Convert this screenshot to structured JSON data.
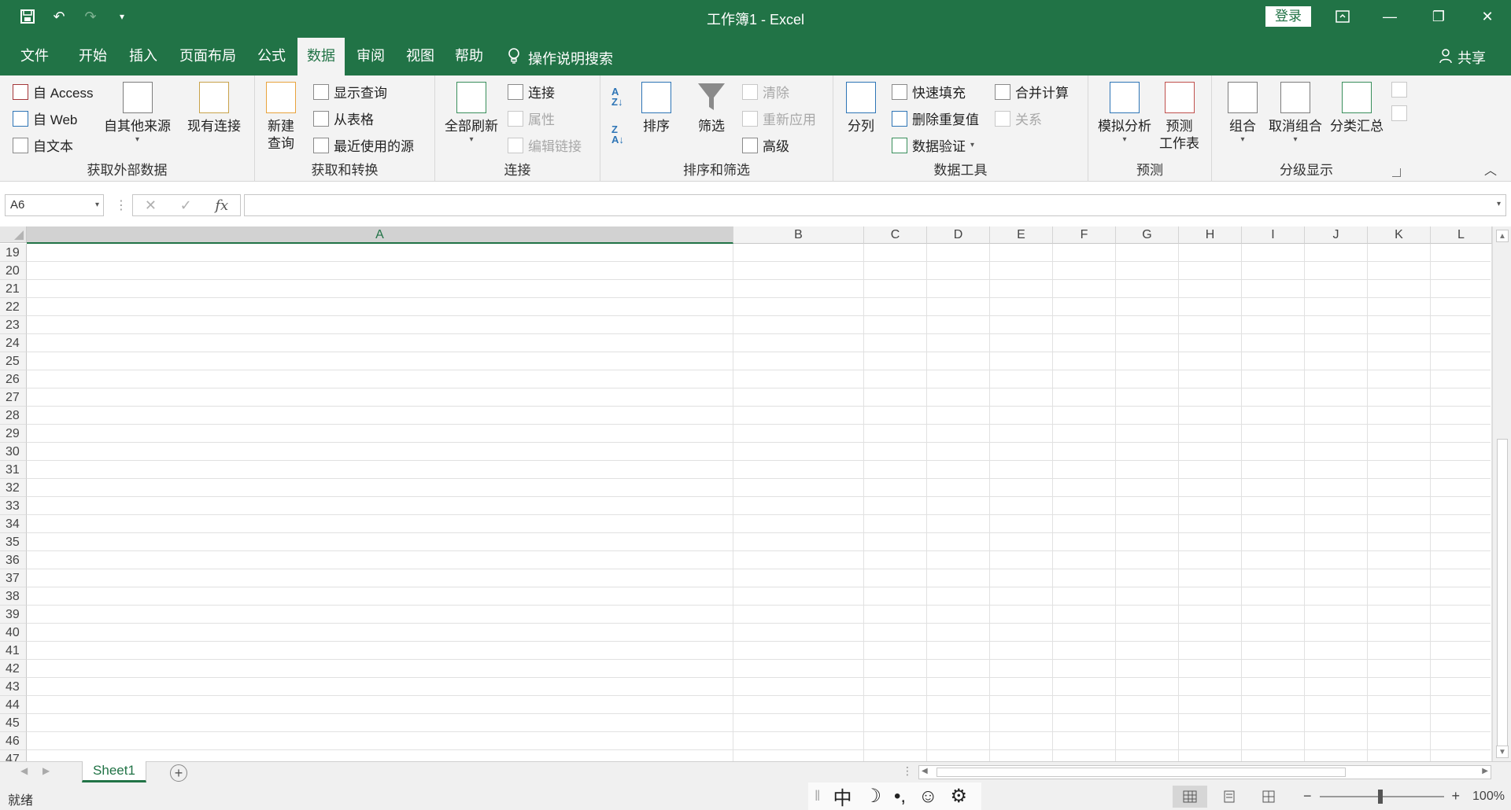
{
  "titlebar": {
    "title": "工作簿1  -  Excel",
    "signin": "登录",
    "quick_access": [
      "save-icon",
      "undo-icon",
      "redo-icon",
      "customize-icon"
    ]
  },
  "tabs": {
    "items": [
      "文件",
      "开始",
      "插入",
      "页面布局",
      "公式",
      "数据",
      "审阅",
      "视图",
      "帮助"
    ],
    "active": "数据",
    "tell_me": "操作说明搜索",
    "share": "共享"
  },
  "ribbon": {
    "get_external": {
      "label": "获取外部数据",
      "access": "自 Access",
      "web": "自 Web",
      "text": "自文本",
      "other_sources": "自其他来源",
      "existing": "现有连接"
    },
    "get_transform": {
      "label": "获取和转换",
      "new_query_line1": "新建",
      "new_query_line2": "查询",
      "show_queries": "显示查询",
      "from_table": "从表格",
      "recent_sources": "最近使用的源"
    },
    "connections": {
      "label": "连接",
      "refresh_all": "全部刷新",
      "connections": "连接",
      "properties": "属性",
      "edit_links": "编辑链接"
    },
    "sort_filter": {
      "label": "排序和筛选",
      "sort": "排序",
      "filter": "筛选",
      "clear": "清除",
      "reapply": "重新应用",
      "advanced": "高级"
    },
    "data_tools": {
      "label": "数据工具",
      "text_to_columns": "分列",
      "flash_fill": "快速填充",
      "remove_duplicates": "删除重复值",
      "data_validation": "数据验证",
      "consolidate": "合并计算",
      "relationships": "关系"
    },
    "forecast": {
      "label": "预测",
      "what_if": "模拟分析",
      "forecast_sheet_line1": "预测",
      "forecast_sheet_line2": "工作表"
    },
    "outline": {
      "label": "分级显示",
      "group": "组合",
      "ungroup": "取消组合",
      "subtotal": "分类汇总"
    }
  },
  "formula_bar": {
    "name_box": "A6",
    "formula": "",
    "fx": "fx"
  },
  "grid": {
    "columns": [
      "A",
      "B",
      "C",
      "D",
      "E",
      "F",
      "G",
      "H",
      "I",
      "J",
      "K",
      "L"
    ],
    "rows": [
      "19",
      "20",
      "21",
      "22",
      "23",
      "24",
      "25",
      "26",
      "27",
      "28",
      "29",
      "30",
      "31",
      "32",
      "33",
      "34",
      "35",
      "36",
      "37",
      "38",
      "39",
      "40",
      "41",
      "42",
      "43",
      "44",
      "45",
      "46",
      "47"
    ],
    "selected_column": "A"
  },
  "sheets": {
    "tabs": [
      "Sheet1"
    ],
    "active": "Sheet1"
  },
  "status": {
    "ready": "就绪",
    "ime": [
      "中",
      "☽",
      "•,",
      "☺",
      "⚙"
    ],
    "zoom": "100%"
  },
  "colors": {
    "accent": "#217346",
    "ribbon_bg": "#f3f3f3"
  }
}
